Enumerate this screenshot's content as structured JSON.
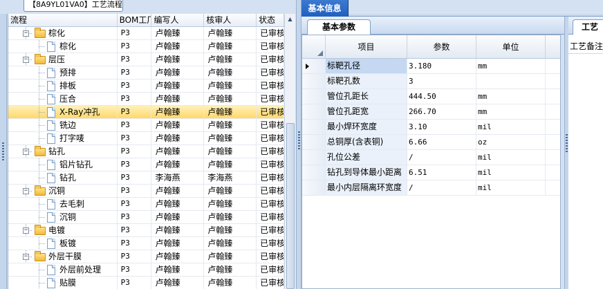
{
  "left_panel": {
    "tab_label": "【8A9YL01VA0】工艺流程",
    "columns": [
      "流程",
      "BOM工厂",
      "编写人",
      "核审人",
      "状态"
    ],
    "rows": [
      {
        "label": "棕化",
        "type": "folder",
        "bom": "P3",
        "writer": "卢翰臻",
        "checker": "卢翰臻",
        "status": "已审核"
      },
      {
        "label": "棕化",
        "type": "doc",
        "bom": "P3",
        "writer": "卢翰臻",
        "checker": "卢翰臻",
        "status": "已审核"
      },
      {
        "label": "层压",
        "type": "folder",
        "bom": "P3",
        "writer": "卢翰臻",
        "checker": "卢翰臻",
        "status": "已审核"
      },
      {
        "label": "预排",
        "type": "doc",
        "bom": "P3",
        "writer": "卢翰臻",
        "checker": "卢翰臻",
        "status": "已审核"
      },
      {
        "label": "排板",
        "type": "doc",
        "bom": "P3",
        "writer": "卢翰臻",
        "checker": "卢翰臻",
        "status": "已审核"
      },
      {
        "label": "压合",
        "type": "doc",
        "bom": "P3",
        "writer": "卢翰臻",
        "checker": "卢翰臻",
        "status": "已审核"
      },
      {
        "label": "X-Ray冲孔",
        "type": "doc",
        "bom": "P3",
        "writer": "卢翰臻",
        "checker": "卢翰臻",
        "status": "已审核",
        "selected": true
      },
      {
        "label": "铣边",
        "type": "doc",
        "bom": "P3",
        "writer": "卢翰臻",
        "checker": "卢翰臻",
        "status": "已审核"
      },
      {
        "label": "打字唛",
        "type": "doc",
        "bom": "P3",
        "writer": "卢翰臻",
        "checker": "卢翰臻",
        "status": "已审核"
      },
      {
        "label": "钻孔",
        "type": "folder",
        "bom": "P3",
        "writer": "卢翰臻",
        "checker": "卢翰臻",
        "status": "已审核"
      },
      {
        "label": "铝片钻孔",
        "type": "doc",
        "bom": "P3",
        "writer": "卢翰臻",
        "checker": "卢翰臻",
        "status": "已审核"
      },
      {
        "label": "钻孔",
        "type": "doc",
        "bom": "P3",
        "writer": "李海燕",
        "checker": "李海燕",
        "status": "已审核"
      },
      {
        "label": "沉铜",
        "type": "folder",
        "bom": "P3",
        "writer": "卢翰臻",
        "checker": "卢翰臻",
        "status": "已审核"
      },
      {
        "label": "去毛刺",
        "type": "doc",
        "bom": "P3",
        "writer": "卢翰臻",
        "checker": "卢翰臻",
        "status": "已审核"
      },
      {
        "label": "沉铜",
        "type": "doc",
        "bom": "P3",
        "writer": "卢翰臻",
        "checker": "卢翰臻",
        "status": "已审核"
      },
      {
        "label": "电镀",
        "type": "folder",
        "bom": "P3",
        "writer": "卢翰臻",
        "checker": "卢翰臻",
        "status": "已审核"
      },
      {
        "label": "板镀",
        "type": "doc",
        "bom": "P3",
        "writer": "卢翰臻",
        "checker": "卢翰臻",
        "status": "已审核"
      },
      {
        "label": "外层干膜",
        "type": "folder",
        "bom": "P3",
        "writer": "卢翰臻",
        "checker": "卢翰臻",
        "status": "已审核"
      },
      {
        "label": "外层前处理",
        "type": "doc",
        "bom": "P3",
        "writer": "卢翰臻",
        "checker": "卢翰臻",
        "status": "已审核"
      },
      {
        "label": "贴膜",
        "type": "doc",
        "bom": "P3",
        "writer": "卢翰臻",
        "checker": "卢翰臻",
        "status": "已审核"
      }
    ]
  },
  "right_panel": {
    "top_tab": "基本信息",
    "sub_tab": "基本参数",
    "columns": [
      "项目",
      "参数",
      "单位"
    ],
    "rows": [
      {
        "item": "标靶孔径",
        "value": "3.180",
        "unit": "mm"
      },
      {
        "item": "标靶孔数",
        "value": "3",
        "unit": ""
      },
      {
        "item": "管位孔距长",
        "value": "444.50",
        "unit": "mm"
      },
      {
        "item": "管位孔距宽",
        "value": "266.70",
        "unit": "mm"
      },
      {
        "item": "最小焊环宽度",
        "value": "3.10",
        "unit": "mil"
      },
      {
        "item": "总铜厚(含表铜)",
        "value": "6.66",
        "unit": "oz"
      },
      {
        "item": "孔位公差",
        "value": "/",
        "unit": "mil"
      },
      {
        "item": "钻孔到导体最小距离",
        "value": "6.51",
        "unit": "mil"
      },
      {
        "item": "最小内层隔离环宽度",
        "value": "/",
        "unit": "mil"
      }
    ],
    "far_tab": "工艺",
    "far_label": "工艺备注"
  },
  "colors": {
    "selected_row": "#ffd86b",
    "tab_blue": "#1f5fbf",
    "panel_bg": "#d4e1f2"
  }
}
